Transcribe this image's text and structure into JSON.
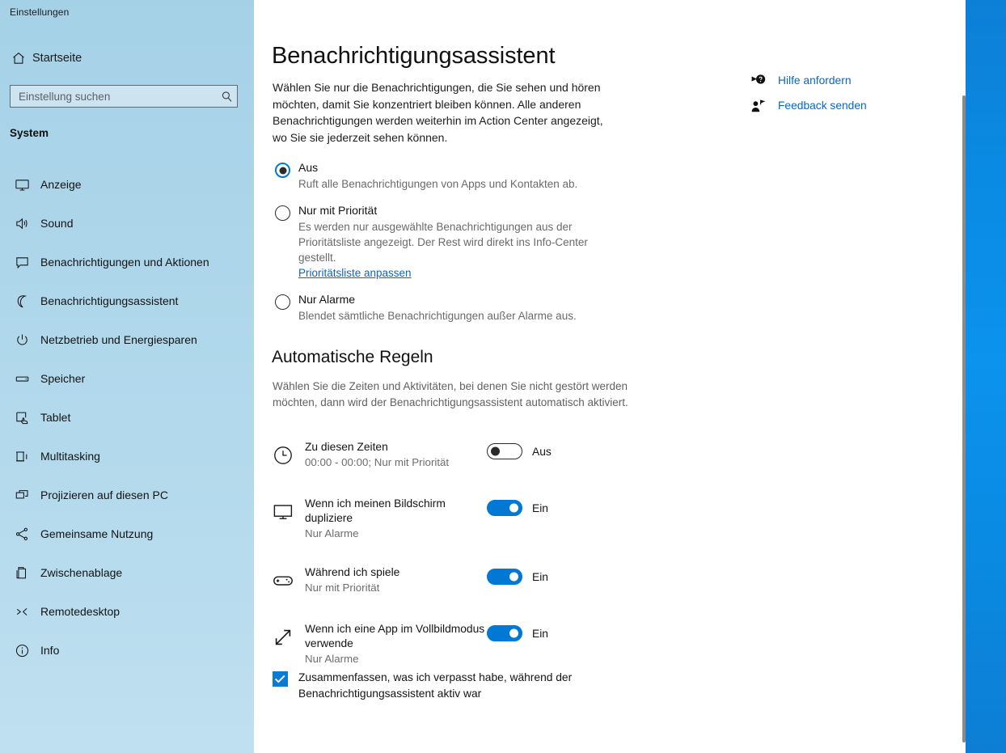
{
  "window": {
    "title": "Einstellungen",
    "controls": {
      "minimize": "minimize-icon",
      "maximize": "maximize-icon",
      "close": "close-icon"
    }
  },
  "sidebar": {
    "home_label": "Startseite",
    "search": {
      "placeholder": "Einstellung suchen",
      "value": ""
    },
    "group_title": "System",
    "items": [
      {
        "label": "Anzeige",
        "icon": "monitor-icon"
      },
      {
        "label": "Sound",
        "icon": "speaker-icon"
      },
      {
        "label": "Benachrichtigungen und Aktionen",
        "icon": "chat-bubble-icon"
      },
      {
        "label": "Benachrichtigungsassistent",
        "icon": "moon-icon"
      },
      {
        "label": "Netzbetrieb und Energiesparen",
        "icon": "power-icon"
      },
      {
        "label": "Speicher",
        "icon": "drive-icon"
      },
      {
        "label": "Tablet",
        "icon": "tablet-icon"
      },
      {
        "label": "Multitasking",
        "icon": "multitasking-icon"
      },
      {
        "label": "Projizieren auf diesen PC",
        "icon": "project-screen-icon"
      },
      {
        "label": "Gemeinsame Nutzung",
        "icon": "share-icon"
      },
      {
        "label": "Zwischenablage",
        "icon": "clipboard-icon"
      },
      {
        "label": "Remotedesktop",
        "icon": "remote-desktop-icon"
      },
      {
        "label": "Info",
        "icon": "info-icon"
      }
    ]
  },
  "main": {
    "page_title": "Benachrichtigungsassistent",
    "intro": "Wählen Sie nur die Benachrichtigungen, die Sie sehen und hören möchten, damit Sie konzentriert bleiben können. Alle anderen Benachrichtigungen werden weiterhin im Action Center angezeigt, wo Sie sie jederzeit sehen können.",
    "mode_options": [
      {
        "label": "Aus",
        "description": "Ruft alle Benachrichtigungen von Apps und Kontakten ab.",
        "selected": true,
        "link": ""
      },
      {
        "label": "Nur mit Priorität",
        "description": "Es werden nur ausgewählte Benachrichtigungen aus der Prioritätsliste angezeigt. Der Rest wird direkt ins Info-Center gestellt.",
        "selected": false,
        "link": "Prioritätsliste anpassen"
      },
      {
        "label": "Nur Alarme",
        "description": "Blendet sämtliche Benachrichtigungen außer Alarme aus.",
        "selected": false,
        "link": ""
      }
    ],
    "rules_section": {
      "title": "Automatische Regeln",
      "description": "Wählen Sie die Zeiten und Aktivitäten, bei denen Sie nicht gestört werden möchten, dann wird der Benachrichtigungsassistent automatisch aktiviert.",
      "rules": [
        {
          "name": "Zu diesen Zeiten",
          "sub": "00:00 - 00:00; Nur mit Priorität",
          "icon": "clock-icon",
          "state": "Aus",
          "on": false
        },
        {
          "name": "Wenn ich meinen Bildschirm dupliziere",
          "sub": "Nur Alarme",
          "icon": "monitor-icon",
          "state": "Ein",
          "on": true
        },
        {
          "name": "Während ich spiele",
          "sub": "Nur mit Priorität",
          "icon": "gamepad-icon",
          "state": "Ein",
          "on": true
        },
        {
          "name": "Wenn ich eine App im Vollbildmodus verwende",
          "sub": "Nur Alarme",
          "icon": "fullscreen-arrows-icon",
          "state": "Ein",
          "on": true
        }
      ]
    },
    "summary_checkbox": {
      "label": "Zusammenfassen, was ich verpasst habe, während der Benachrichtigungsassistent aktiv war",
      "checked": true
    }
  },
  "help": {
    "links": [
      {
        "label": "Hilfe anfordern",
        "icon": "help-question-icon"
      },
      {
        "label": "Feedback senden",
        "icon": "feedback-person-icon"
      }
    ]
  },
  "colors": {
    "accent": "#0078d4",
    "link": "#0a66c2",
    "sidebar_top": "#a5d1e7",
    "sidebar_bottom": "#bfe0f0",
    "desktop": "#0b93ee"
  }
}
